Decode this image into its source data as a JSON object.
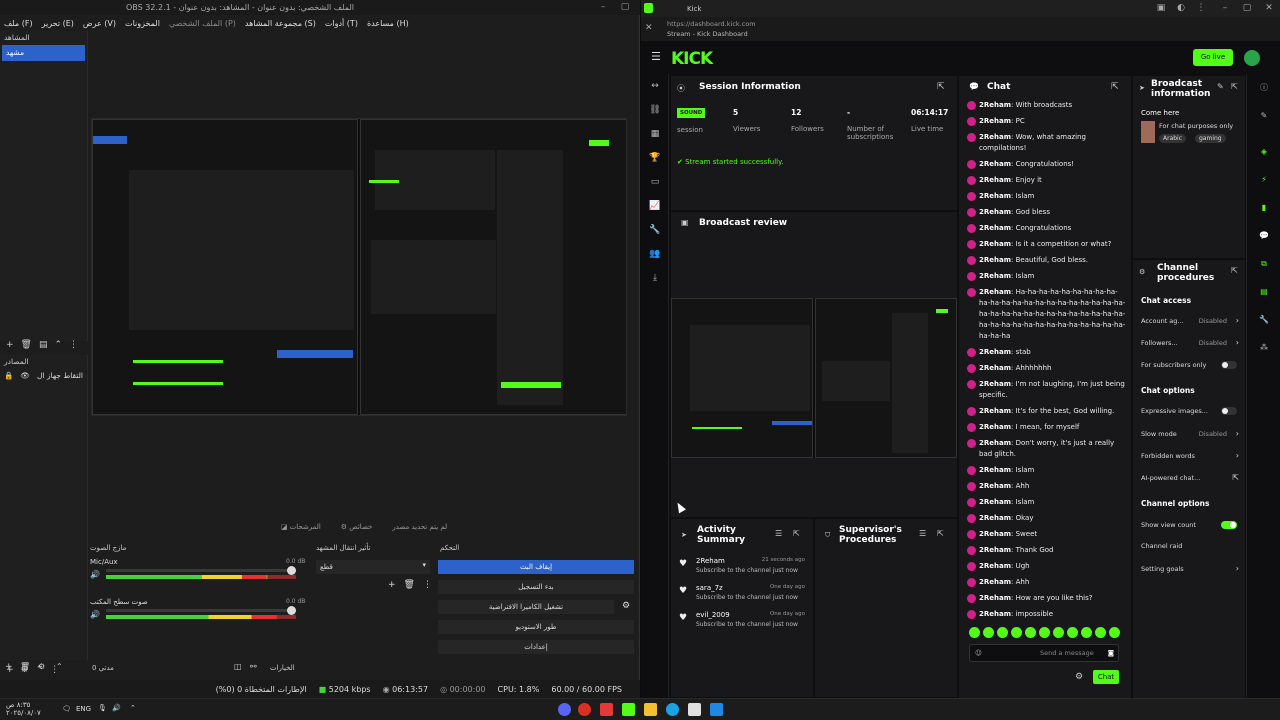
{
  "obs": {
    "title": "OBS 32.2.1 - الملف الشخصي: بدون عنوان - المشاهد: بدون عنوان",
    "menu": [
      "ملف (F)",
      "تحرير (E)",
      "عرض (V)",
      "المخزونات",
      "الملف الشخصي (P)",
      "مجموعة المشاهد (S)",
      "أدوات (T)",
      "مساعدة (H)"
    ],
    "scenes_header": "المشاهد",
    "scene_item": "مشهد",
    "sources_header": "المصادر",
    "source_item": "التقاط جهاز ال",
    "no_source_selected": "لم يتم تحديد مصدر",
    "properties": "خصائص",
    "filters": "المرشحات",
    "audio_mixer_header": "مازج الصوت",
    "mic_label": "Mic/Aux",
    "mic_db": "0.0 dB",
    "desktop_label": "صوت سطح المكتب",
    "desktop_db": "0.0 dB",
    "transitions_header": "تأثير انتقال المشهد",
    "transition_value": "قطع",
    "controls_header": "التحكم",
    "stop_stream": "إيقاف البث",
    "start_recording": "بدء التسجيل",
    "start_virtualcam": "تشغيل الكاميرا الافتراضية",
    "studio_mode": "طور الاستوديو",
    "settings": "إعدادات",
    "options": "الخيارات",
    "duration_label": "مدتي 0",
    "status": {
      "dropped": "الإطارات المتخطاة 0 (0%)",
      "bitrate": "5204 kbps",
      "stream_time": "06:13:57",
      "rec_time": "00:00:00",
      "cpu": "CPU: 1.8%",
      "fps": "60.00 / 60.00 FPS"
    }
  },
  "browser": {
    "tab_title": "Kick",
    "url": "https://dashboard.kick.com",
    "page_title": "Stream - Kick Dashboard"
  },
  "kick": {
    "logo": "KICK",
    "go_live": "Go live",
    "session": {
      "title": "Session Information",
      "badge": "SOUND",
      "session_label": "session",
      "viewers_value": "5",
      "viewers_label": "Viewers",
      "followers_value": "12",
      "followers_label": "Followers",
      "subs_value": "-",
      "subs_label": "Number of subscriptions",
      "live_value": "06:14:17",
      "live_label": "Live time",
      "notice": "Stream started successfully."
    },
    "review_title": "Broadcast review",
    "activity": {
      "title": "Activity Summary",
      "items": [
        {
          "user": "2Reham",
          "time": "21 seconds ago",
          "desc": "Subscribe to the channel just now"
        },
        {
          "user": "sara_7z",
          "time": "One day ago",
          "desc": "Subscribe to the channel just now"
        },
        {
          "user": "evil_2009",
          "time": "One day ago",
          "desc": "Subscribe to the channel just now"
        }
      ]
    },
    "supervisor_title": "Supervisor's Procedures",
    "chat": {
      "title": "Chat",
      "messages": [
        {
          "user": "2Reham",
          "text": "With broadcasts"
        },
        {
          "user": "2Reham",
          "text": "PC"
        },
        {
          "user": "2Reham",
          "text": "Wow, what amazing compilations!"
        },
        {
          "user": "2Reham",
          "text": "Congratulations!"
        },
        {
          "user": "2Reham",
          "text": "Enjoy it"
        },
        {
          "user": "2Reham",
          "text": "Islam"
        },
        {
          "user": "2Reham",
          "text": "God bless"
        },
        {
          "user": "2Reham",
          "text": "Congratulations"
        },
        {
          "user": "2Reham",
          "text": "Is it a competition or what?"
        },
        {
          "user": "2Reham",
          "text": "Beautiful, God bless."
        },
        {
          "user": "2Reham",
          "text": "Islam"
        },
        {
          "user": "2Reham",
          "text": "Ha-ha-ha-ha-ha-ha-ha-ha-ha-ha-ha-ha-ha-ha-ha-ha-ha-ha-ha-ha-ha-ha-ha-ha-ha-ha-ha-ha-ha-ha-ha-ha-ha-ha-ha-ha-ha-ha-ha-ha-ha-ha-ha-ha-ha-ha-ha-ha-ha-ha-ha"
        },
        {
          "user": "2Reham",
          "text": "stab"
        },
        {
          "user": "2Reham",
          "text": "Ahhhhhhh"
        },
        {
          "user": "2Reham",
          "text": "I'm not laughing, I'm just being specific."
        },
        {
          "user": "2Reham",
          "text": "It's for the best, God willing."
        },
        {
          "user": "2Reham",
          "text": "I mean, for myself"
        },
        {
          "user": "2Reham",
          "text": "Don't worry, it's just a really bad glitch."
        },
        {
          "user": "2Reham",
          "text": "Islam"
        },
        {
          "user": "2Reham",
          "text": "Ahh"
        },
        {
          "user": "2Reham",
          "text": "Islam"
        },
        {
          "user": "2Reham",
          "text": "Okay"
        },
        {
          "user": "2Reham",
          "text": "Sweet"
        },
        {
          "user": "2Reham",
          "text": "Thank God"
        },
        {
          "user": "2Reham",
          "text": "Ugh"
        },
        {
          "user": "2Reham",
          "text": "Ahh"
        },
        {
          "user": "2Reham",
          "text": "How are you like this?"
        },
        {
          "user": "2Reham",
          "text": "impossible"
        }
      ],
      "placeholder": "Send a message",
      "send": "Chat"
    },
    "broadcast_info": {
      "title": "Broadcast information",
      "stream_title": "Come here",
      "category": "For chat purposes only",
      "tags": [
        "Arabic",
        "gaming"
      ]
    },
    "channel_procedures": {
      "title": "Channel procedures",
      "chat_access": "Chat access",
      "account_age": "Account ag...",
      "account_age_val": "Disabled",
      "followers": "Followers...",
      "followers_val": "Disabled",
      "subs_only": "For subscribers only",
      "chat_options": "Chat options",
      "expressive": "Expressive images...",
      "slow_mode": "Slow mode",
      "slow_mode_val": "Disabled",
      "forbidden": "Forbidden words",
      "ai_chat": "AI-powered chat...",
      "channel_options": "Channel options",
      "show_view": "Show view count",
      "channel_raid": "Channel raid",
      "setting_goals": "Setting goals"
    }
  },
  "taskbar": {
    "lang": "ENG",
    "time": "٨:٣٥ ص",
    "date": "٢٠٢٥/٠٨/٠٧"
  },
  "colors": {
    "kick_green": "#53fc18",
    "obs_blue": "#2c62c9",
    "chat_avatar": "#d4218a"
  }
}
